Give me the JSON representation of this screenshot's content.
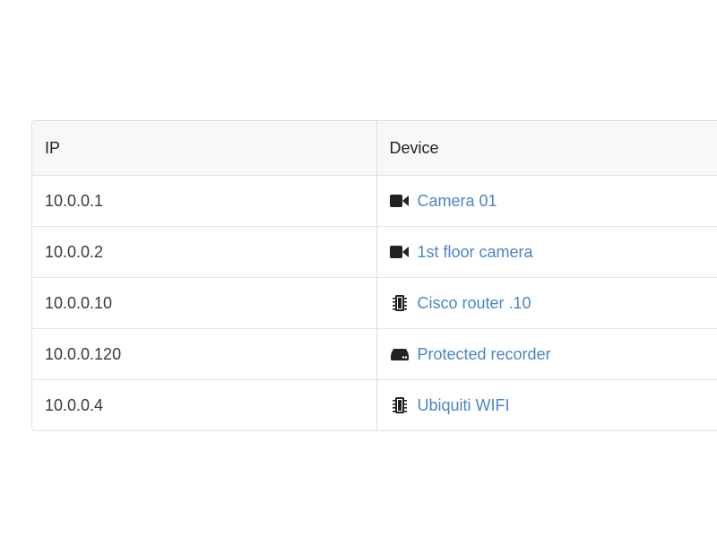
{
  "table": {
    "headers": {
      "ip": "IP",
      "device": "Device"
    },
    "rows": [
      {
        "ip": "10.0.0.1",
        "device": "Camera 01",
        "icon": "video-camera-icon"
      },
      {
        "ip": "10.0.0.2",
        "device": "1st floor camera",
        "icon": "video-camera-icon"
      },
      {
        "ip": "10.0.0.10",
        "device": "Cisco router .10",
        "icon": "chip-icon"
      },
      {
        "ip": "10.0.0.120",
        "device": "Protected recorder",
        "icon": "recorder-hdd-icon"
      },
      {
        "ip": "10.0.0.4",
        "device": "Ubiquiti WIFI",
        "icon": "chip-icon"
      }
    ],
    "link_color": "#4a86c5"
  }
}
